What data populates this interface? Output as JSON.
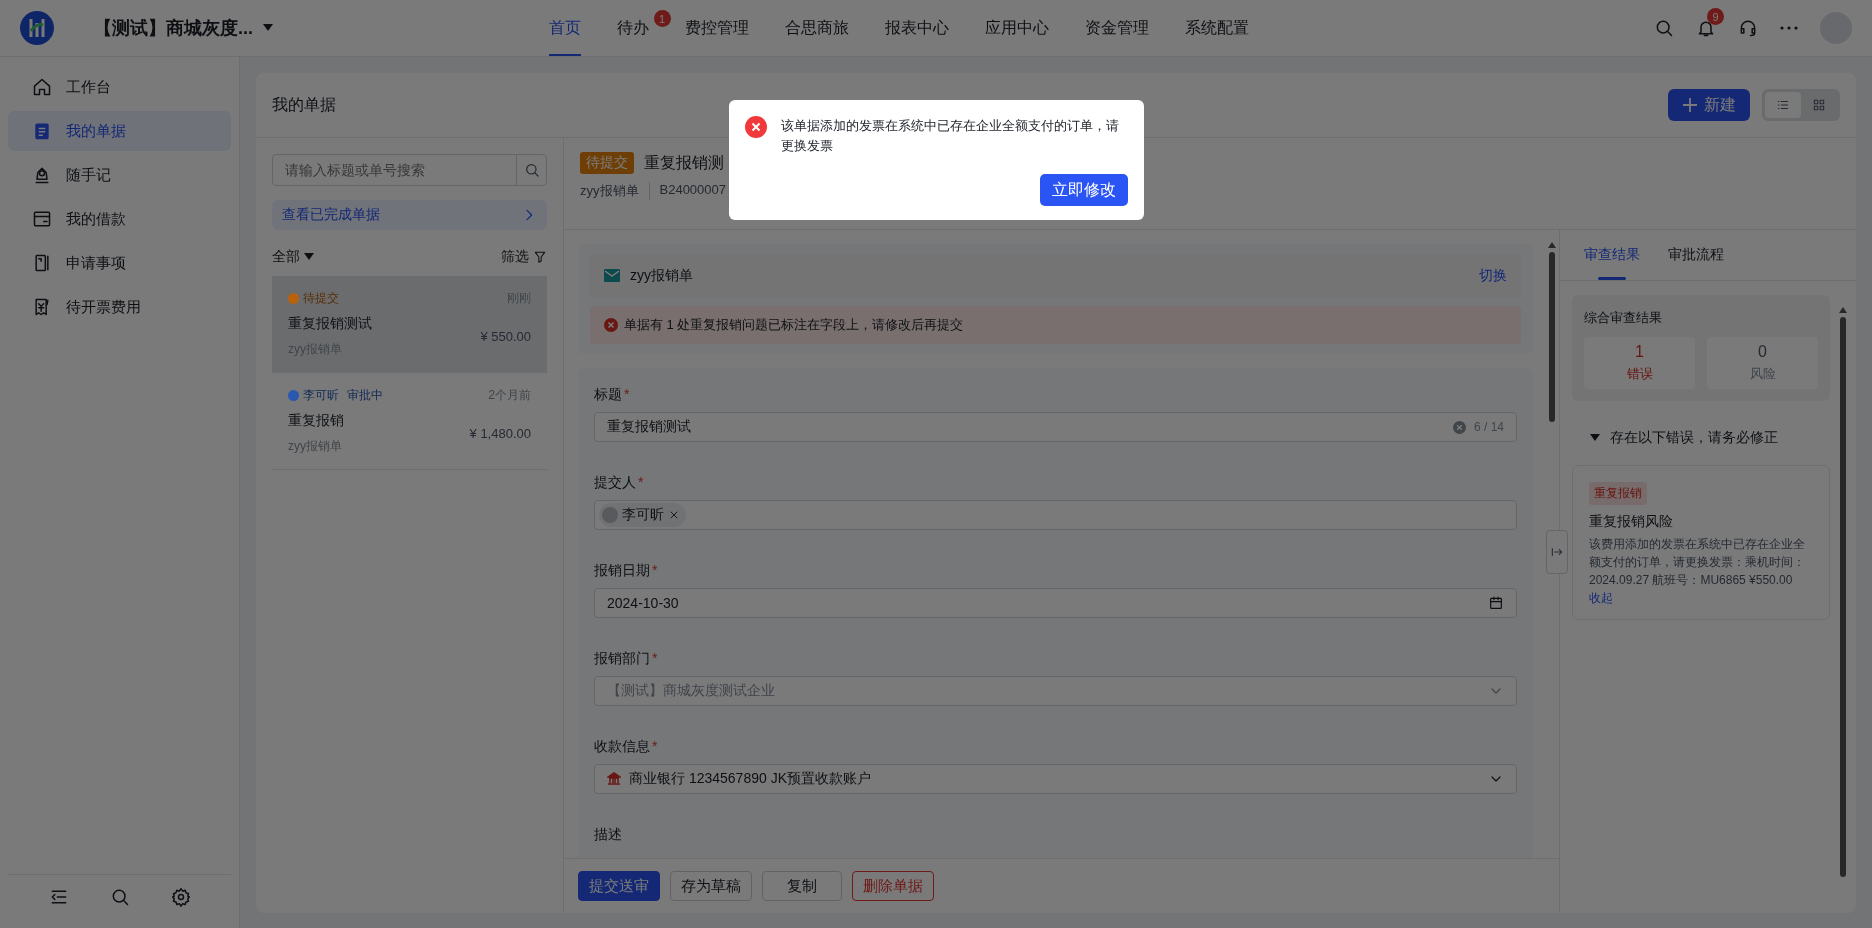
{
  "topbar": {
    "org_name": "【测试】商城灰度...",
    "nav": [
      {
        "label": "首页",
        "selected": true
      },
      {
        "label": "待办",
        "selected": false,
        "badge": "1"
      },
      {
        "label": "费控管理",
        "selected": false
      },
      {
        "label": "合思商旅",
        "selected": false
      },
      {
        "label": "报表中心",
        "selected": false
      },
      {
        "label": "应用中心",
        "selected": false
      },
      {
        "label": "资金管理",
        "selected": false
      },
      {
        "label": "系统配置",
        "selected": false
      }
    ],
    "notification_badge": "9"
  },
  "sidebar": {
    "items": [
      {
        "label": "工作台",
        "selected": false
      },
      {
        "label": "我的单据",
        "selected": true
      },
      {
        "label": "随手记",
        "selected": false
      },
      {
        "label": "我的借款",
        "selected": false
      },
      {
        "label": "申请事项",
        "selected": false
      },
      {
        "label": "待开票费用",
        "selected": false
      }
    ]
  },
  "page": {
    "title": "我的单据",
    "new_button": "新建",
    "view_modes": [
      {
        "selected": true
      },
      {
        "selected": false
      }
    ]
  },
  "list": {
    "search_placeholder": "请输入标题或单号搜索",
    "completed_link": "查看已完成单据",
    "scope": "全部",
    "filter": "筛选",
    "items": [
      {
        "status": "待提交",
        "color": "#b8620c",
        "time": "刚刚",
        "title": "重复报销测试",
        "type": "zyy报销单",
        "amount": "¥ 550.00",
        "selected": true
      },
      {
        "submitter": "李可昕",
        "status": "审批中",
        "color": "#2a58b0",
        "time": "2个月前",
        "title": "重复报销",
        "type": "zyy报销单",
        "amount": "¥ 1,480.00",
        "selected": false
      }
    ]
  },
  "detail": {
    "status_tag": "待提交",
    "title": "重复报销测",
    "form_type": "zyy报销单",
    "number": "B24000007"
  },
  "form": {
    "template": "zyy报销单",
    "switch_link": "切换",
    "error_banner": "单据有 1 处重复报销问题已标注在字段上，请修改后再提交",
    "fields": [
      {
        "kind": "text",
        "label": "标题",
        "required_mark": "*",
        "value": "重复报销测试",
        "counter": "6 / 14"
      },
      {
        "kind": "tags",
        "label": "提交人",
        "required_mark": "*",
        "tags": [
          "李可昕"
        ]
      },
      {
        "kind": "date",
        "label": "报销日期",
        "required_mark": "*",
        "value": "2024-10-30"
      },
      {
        "kind": "select",
        "label": "报销部门",
        "required_mark": "*",
        "value": "【测试】商城灰度测试企业",
        "disabled": true
      },
      {
        "kind": "bank",
        "label": "收款信息",
        "required_mark": "*",
        "value": "商业银行 1234567890 JK预置收款账户",
        "disabled": false
      },
      {
        "kind": "label",
        "label": "描述"
      }
    ]
  },
  "actions": [
    {
      "label": "提交送审",
      "kind": "primary"
    },
    {
      "label": "存为草稿",
      "kind": "default"
    },
    {
      "label": "复制",
      "kind": "default"
    },
    {
      "label": "删除单据",
      "kind": "danger"
    }
  ],
  "review": {
    "tabs": [
      {
        "label": "审查结果",
        "selected": true
      },
      {
        "label": "审批流程",
        "selected": false
      }
    ],
    "summary_title": "综合审查结果",
    "stats": [
      {
        "value": "1",
        "label": "错误",
        "kind": "error"
      },
      {
        "value": "0",
        "label": "风险",
        "kind": "risk"
      }
    ],
    "section_title": "存在以下错误，请务必修正",
    "expanded": true,
    "issues": [
      {
        "tag": "重复报销",
        "title": "重复报销风险",
        "description": "该费用添加的发票在系统中已存在企业全额支付的订单，请更换发票：乘机时间：2024.09.27 航班号：MU6865 ¥550.00",
        "toggle": "收起"
      }
    ]
  },
  "modal": {
    "message": "该单据添加的发票在系统中已存在企业全额支付的订单，请更换发票",
    "button": "立即修改"
  }
}
